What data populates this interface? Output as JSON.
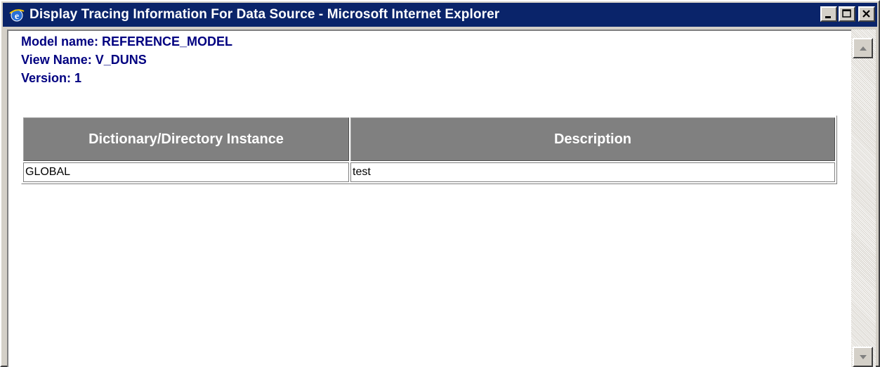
{
  "window": {
    "title": "Display Tracing Information For Data Source - Microsoft Internet Explorer"
  },
  "info": {
    "model_name": "Model name: REFERENCE_MODEL",
    "view_name": "View Name: V_DUNS",
    "version": "Version: 1"
  },
  "table": {
    "headers": [
      "Dictionary/Directory Instance",
      "Description"
    ],
    "rows": [
      [
        "GLOBAL",
        "test"
      ]
    ]
  },
  "colors": {
    "titlebar": "#0a246a",
    "info_text": "#000080",
    "table_header_bg": "#808080"
  },
  "icons": {
    "app": "internet-explorer-icon",
    "minimize": "minimize-icon",
    "maximize": "maximize-icon",
    "close": "close-icon",
    "scroll_up": "arrow-up-icon",
    "scroll_down": "arrow-down-icon"
  }
}
